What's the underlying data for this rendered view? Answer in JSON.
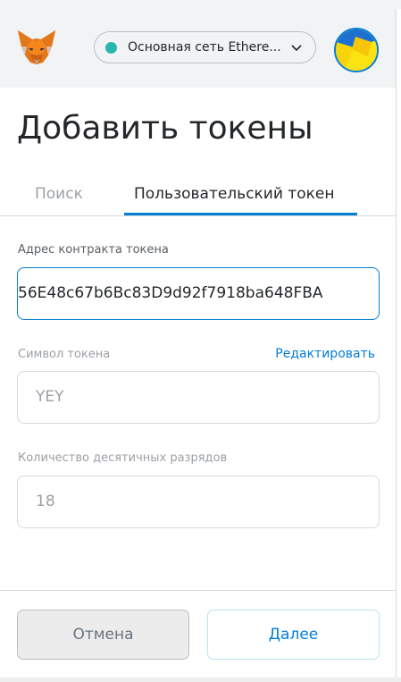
{
  "header": {
    "network": {
      "label": "Основная сеть Ethere...",
      "dot_color": "#29b6af"
    },
    "logo_icon": "metamask-fox-icon",
    "avatar_icon": "account-identicon"
  },
  "page": {
    "title": "Добавить токены"
  },
  "tabs": [
    {
      "label": "Поиск",
      "active": false
    },
    {
      "label": "Пользовательский токен",
      "active": true
    }
  ],
  "form": {
    "address": {
      "label": "Адрес контракта токена",
      "value": "56E48c67b6Bc83D9d92f7918ba648FBA"
    },
    "symbol": {
      "label": "Символ токена",
      "edit_label": "Редактировать",
      "value": "YEY"
    },
    "decimals": {
      "label": "Количество десятичных разрядов",
      "value": "18"
    }
  },
  "footer": {
    "cancel_label": "Отмена",
    "next_label": "Далее"
  },
  "colors": {
    "accent": "#037dd6",
    "header_bg": "#f2f3f4",
    "muted_text": "#9ca0a5"
  }
}
